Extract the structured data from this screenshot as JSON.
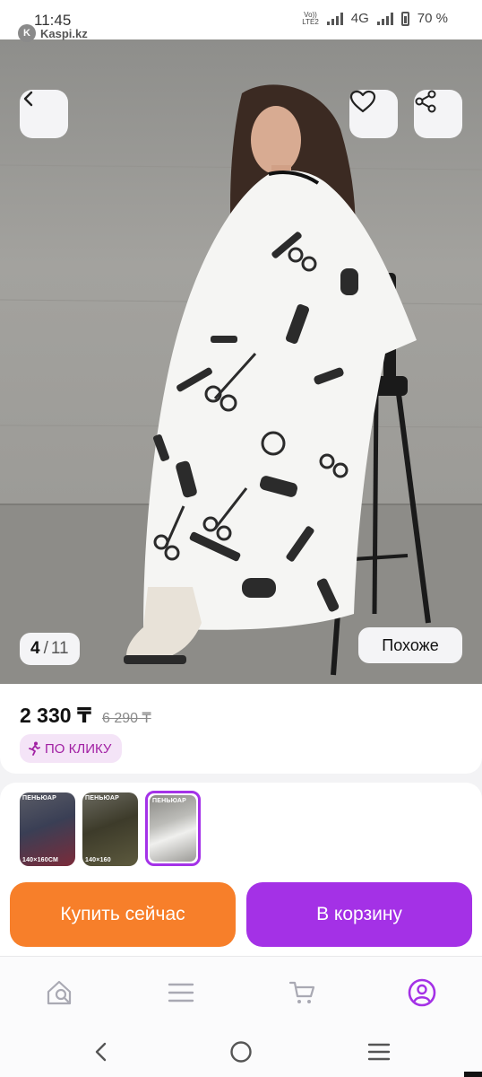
{
  "status_bar": {
    "time": "11:45",
    "network_top": "Vo))",
    "network_bottom": "LTE2",
    "network_type": "4G",
    "battery": "70 %",
    "app_name": "Kaspi.kz"
  },
  "gallery": {
    "current": "4",
    "separator": "/",
    "total": "11",
    "similar_label": "Похоже"
  },
  "product": {
    "price": "2 330 ₸",
    "old_price": "6 290 ₸",
    "promo_label": "ПО КЛИКУ"
  },
  "thumbnails": [
    {
      "label": "ПЕНЬЮАР",
      "sub": "140×160СМ",
      "selected": false
    },
    {
      "label": "ПЕНЬЮАР",
      "sub": "140×160",
      "selected": false
    },
    {
      "label": "ПЕНЬЮАР",
      "sub": "",
      "selected": true
    }
  ],
  "actions": {
    "buy_now": "Купить сейчас",
    "add_to_cart": "В корзину"
  },
  "tab_bar": {
    "items": [
      "home-search-icon",
      "menu-icon",
      "cart-icon",
      "profile-icon"
    ],
    "active_index": 3
  },
  "colors": {
    "accent_purple": "#a431e6",
    "accent_orange": "#f77f2a",
    "promo_text": "#a11fa3"
  }
}
